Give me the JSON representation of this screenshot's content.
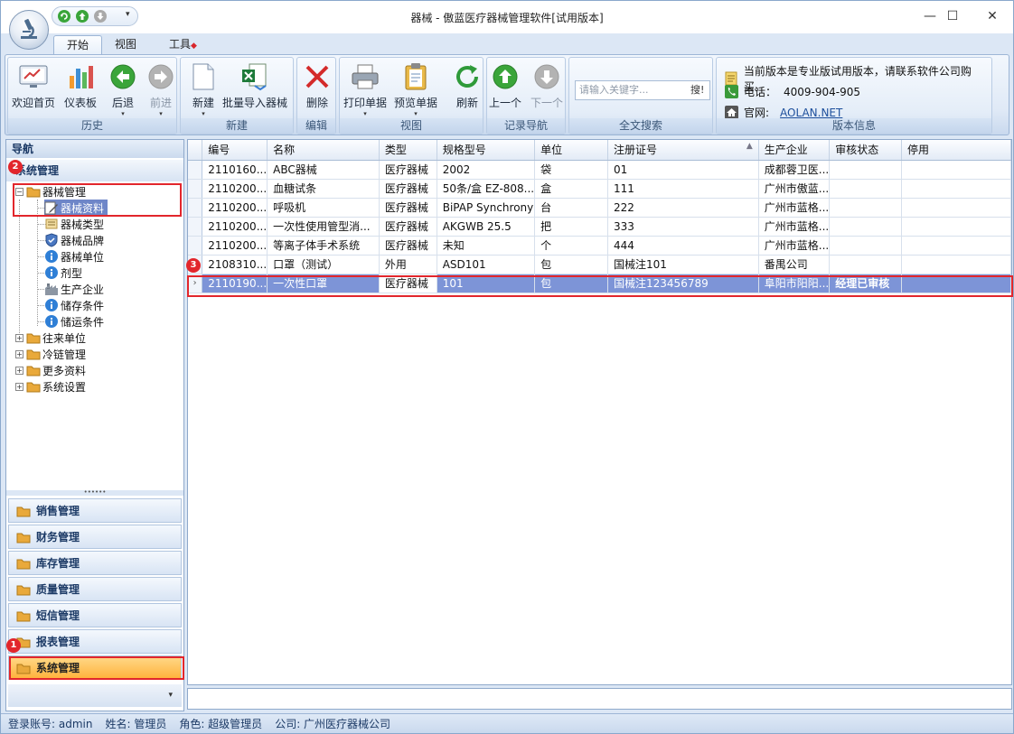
{
  "window": {
    "title": "器械 - 傲蓝医疗器械管理软件[试用版本]"
  },
  "ribbon_tabs": [
    "开始",
    "视图",
    "工具"
  ],
  "ribbon": {
    "groups": {
      "history": "历史",
      "new": "新建",
      "edit": "编辑",
      "view": "视图",
      "record_nav": "记录导航",
      "search": "全文搜索",
      "version": "版本信息"
    },
    "buttons": {
      "home": "欢迎首页",
      "dashboard": "仪表板",
      "back": "后退",
      "forward": "前进",
      "new": "新建",
      "batch_import": "批量导入器械",
      "delete": "删除",
      "print": "打印单据",
      "preview": "预览单据",
      "refresh": "刷新",
      "prev": "上一个",
      "next": "下一个"
    },
    "search": {
      "placeholder": "请输入关键字...",
      "button": "搜!"
    },
    "version_info": {
      "notice": "当前版本是专业版试用版本，请联系软件公司购买。",
      "phone_label": "电话：",
      "phone": "4009-904-905",
      "site_label": "官网:",
      "site": "AOLAN.NET"
    }
  },
  "nav": {
    "header": "导航",
    "section": "系统管理",
    "tree": {
      "root": "器械管理",
      "children": [
        "器械资料",
        "器械类型",
        "器械品牌",
        "器械单位",
        "剂型",
        "生产企业",
        "储存条件",
        "储运条件"
      ],
      "others": [
        "往来单位",
        "冷链管理",
        "更多资料",
        "系统设置"
      ]
    },
    "modules": [
      "销售管理",
      "财务管理",
      "库存管理",
      "质量管理",
      "短信管理",
      "报表管理",
      "系统管理"
    ],
    "active_module": "系统管理"
  },
  "grid": {
    "columns": [
      "编号",
      "名称",
      "类型",
      "规格型号",
      "单位",
      "注册证号",
      "生产企业",
      "审核状态",
      "停用"
    ],
    "rows": [
      [
        "2110160...",
        "ABC器械",
        "医疗器械",
        "2002",
        "袋",
        "01",
        "成都蓉卫医...",
        "",
        ""
      ],
      [
        "2110200...",
        "血糖试条",
        "医疗器械",
        "50条/盒 EZ-808...",
        "盒",
        "111",
        "广州市傲蓝...",
        "",
        ""
      ],
      [
        "2110200...",
        "呼吸机",
        "医疗器械",
        "BiPAP Synchrony",
        "台",
        "222",
        "广州市蓝格...",
        "",
        ""
      ],
      [
        "2110200...",
        "一次性使用管型消...",
        "医疗器械",
        "AKGWB 25.5",
        "把",
        "333",
        "广州市蓝格...",
        "",
        ""
      ],
      [
        "2110200...",
        "等离子体手术系统",
        "医疗器械",
        "未知",
        "个",
        "444",
        "广州市蓝格...",
        "",
        ""
      ],
      [
        "2108310...",
        "口罩（测试）",
        "外用",
        "ASD101",
        "包",
        "国械注101",
        "番禺公司",
        "",
        ""
      ],
      [
        "2110190...",
        "一次性口罩",
        "医疗器械",
        "101",
        "包",
        "国械注123456789",
        "阜阳市阳阳...",
        "经理已审核",
        ""
      ]
    ],
    "selected_row": 6
  },
  "status": {
    "account": "登录账号: admin",
    "name": "姓名: 管理员",
    "role": "角色: 超级管理员",
    "company": "公司: 广州医疗器械公司"
  },
  "annotations": [
    "1",
    "2",
    "3"
  ]
}
